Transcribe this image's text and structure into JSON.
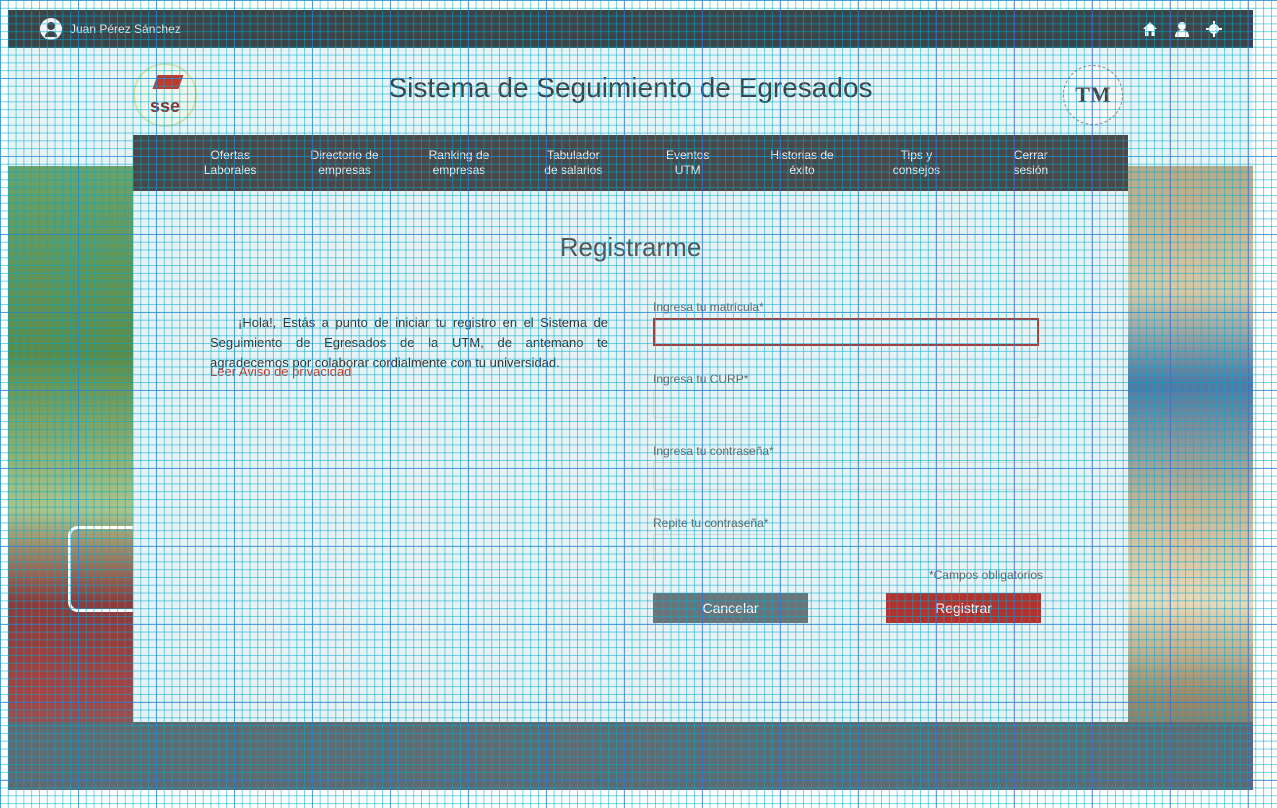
{
  "topbar": {
    "user_name": "Juan Pérez Sánchez",
    "icons": [
      "home-icon",
      "user-icon",
      "gear-icon"
    ]
  },
  "header": {
    "site_title": "Sistema de Seguimiento de Egresados",
    "logo_left_text": "sse",
    "logo_right_text": "TM"
  },
  "nav": {
    "items": [
      {
        "line1": "Ofertas",
        "line2": "Laborales"
      },
      {
        "line1": "Directorio de",
        "line2": "empresas"
      },
      {
        "line1": "Ranking de",
        "line2": "empresas"
      },
      {
        "line1": "Tabulador",
        "line2": "de salarios"
      },
      {
        "line1": "Eventos",
        "line2": "UTM"
      },
      {
        "line1": "Historias de",
        "line2": "éxito"
      },
      {
        "line1": "Tips y",
        "line2": "consejos"
      },
      {
        "line1": "Cerrar",
        "line2": "sesión"
      }
    ]
  },
  "panel": {
    "title": "Registrarme",
    "intro": "¡Hola!, Estás a punto de iniciar tu registro en el Sistema de Seguimiento de Egresados de la UTM, de antemano te agradecemos por colaborar cordialmente con tu universidad.",
    "privacy_link": "Leer Aviso de privacidad"
  },
  "form": {
    "matricula_label": "Ingresa tu matrícula*",
    "matricula_value": "",
    "curp_label": "Ingresa tu CURP*",
    "curp_value": "",
    "password_label": "Ingresa tu contraseña*",
    "password_value": "",
    "repeat_label": "Repite tu contraseña*",
    "repeat_value": "",
    "required_note": "*Campos obligatorios",
    "cancel_label": "Cancelar",
    "register_label": "Registrar"
  },
  "colors": {
    "topbar": "#3d4448",
    "nav": "#4a4748",
    "accent_red": "#b3322d",
    "cancel_gray": "#6b7478"
  }
}
